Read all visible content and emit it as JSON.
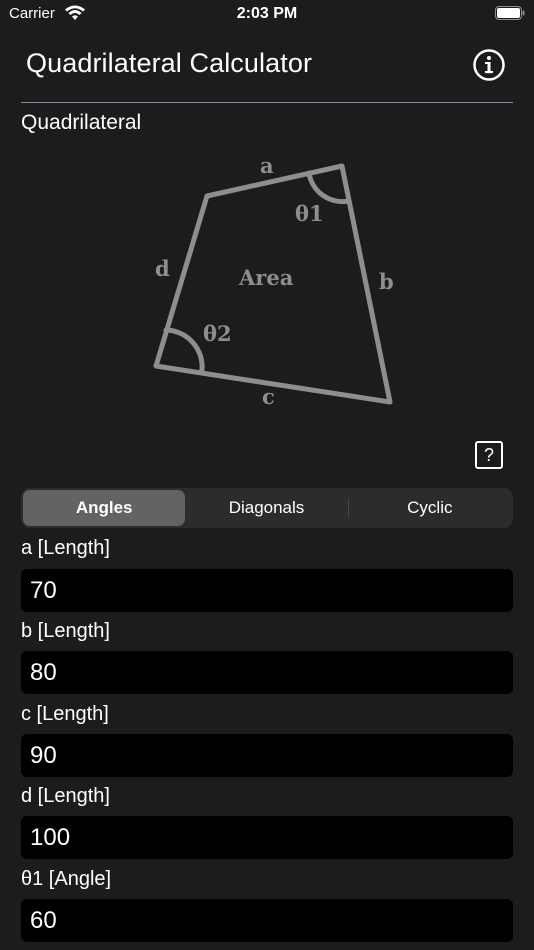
{
  "status_bar": {
    "carrier": "Carrier",
    "time": "2:03 PM",
    "wifi_icon": "wifi-icon",
    "battery_icon": "battery-icon"
  },
  "header": {
    "title": "Quadrilateral Calculator",
    "info_icon": "info-icon"
  },
  "section": {
    "label": "Quadrilateral"
  },
  "diagram": {
    "labels": {
      "a": "a",
      "b": "b",
      "c": "c",
      "d": "d",
      "area": "Area",
      "theta1": "θ1",
      "theta2": "θ2"
    },
    "stroke_color": "#8e8e8e"
  },
  "help_button": {
    "label": "?"
  },
  "tabs": {
    "items": [
      {
        "label": "Angles",
        "active": true
      },
      {
        "label": "Diagonals",
        "active": false
      },
      {
        "label": "Cyclic",
        "active": false
      }
    ]
  },
  "fields": [
    {
      "label": "a [Length]",
      "value": "70"
    },
    {
      "label": "b [Length]",
      "value": "80"
    },
    {
      "label": "c [Length]",
      "value": "90"
    },
    {
      "label": "d [Length]",
      "value": "100"
    },
    {
      "label": "θ1 [Angle]",
      "value": "60"
    }
  ]
}
